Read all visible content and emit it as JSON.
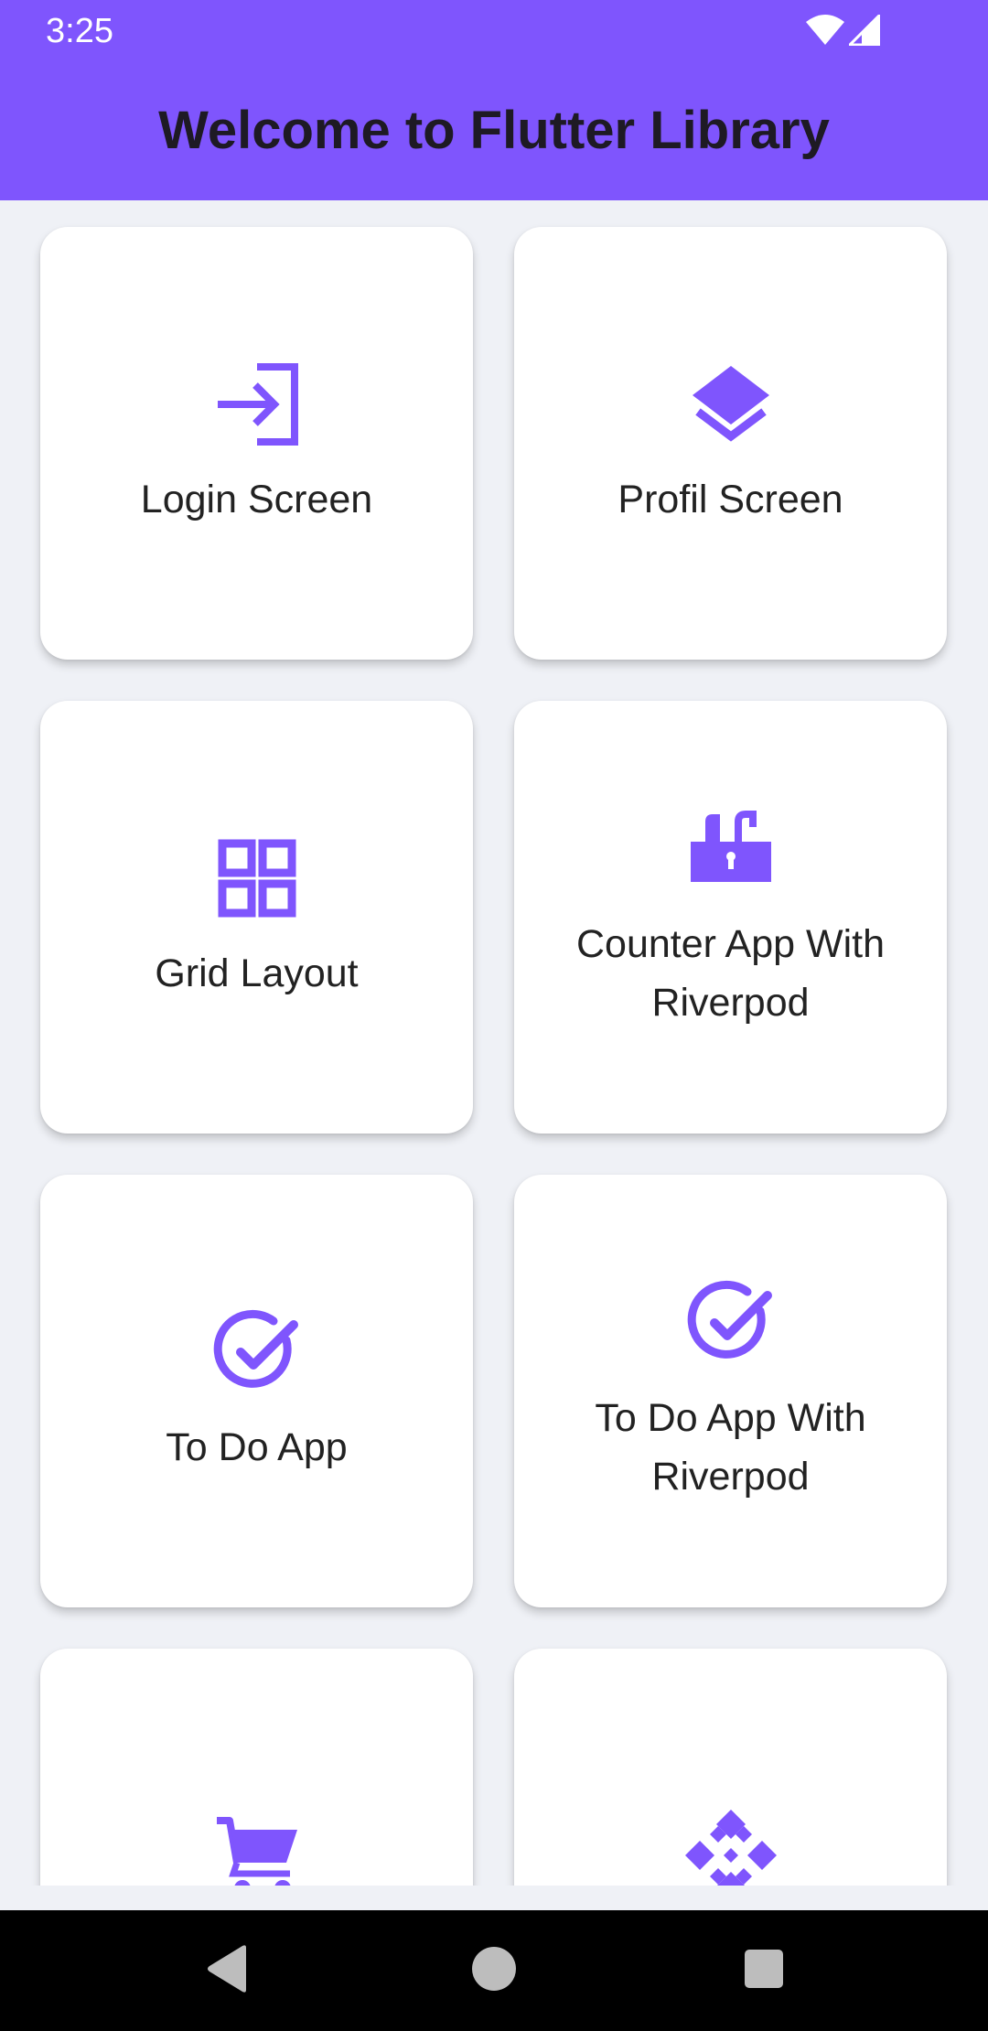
{
  "status_bar": {
    "time": "3:25",
    "icons": [
      "wifi-icon",
      "cellular-signal-icon"
    ]
  },
  "app_bar": {
    "title": "Welcome to Flutter Library",
    "color": "#7f55fd"
  },
  "accent_color": "#7f55fd",
  "grid": {
    "items": [
      {
        "label": "Login Screen",
        "icon": "login-icon"
      },
      {
        "label": "Profil Screen",
        "icon": "layers-icon"
      },
      {
        "label": "Grid Layout",
        "icon": "grid-view-icon"
      },
      {
        "label": "Counter App With Riverpod",
        "icon": "lock-open-icon"
      },
      {
        "label": "To Do App",
        "icon": "check-circle-icon"
      },
      {
        "label": "To Do App With Riverpod",
        "icon": "check-circle-icon"
      },
      {
        "label": "",
        "icon": "shopping-cart-icon"
      },
      {
        "label": "",
        "icon": "diamond-pattern-icon"
      }
    ]
  },
  "nav_bar": {
    "buttons": [
      "back-icon",
      "home-icon",
      "recents-icon"
    ]
  }
}
